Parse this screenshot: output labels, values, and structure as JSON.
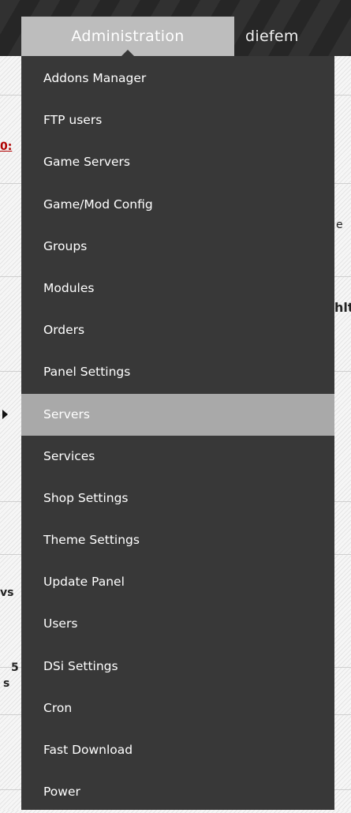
{
  "nav": {
    "tabs": [
      {
        "label": "Administration",
        "active": true
      },
      {
        "label": "diefem",
        "active": false
      }
    ]
  },
  "background_fragments": {
    "link": "0:",
    "e": "e",
    "hlt": "hlt",
    "vs": "vs",
    "five": "5",
    "s": "s"
  },
  "menu": {
    "items": [
      {
        "label": "Addons Manager"
      },
      {
        "label": "FTP users"
      },
      {
        "label": "Game Servers"
      },
      {
        "label": "Game/Mod Config"
      },
      {
        "label": "Groups"
      },
      {
        "label": "Modules"
      },
      {
        "label": "Orders"
      },
      {
        "label": "Panel Settings"
      },
      {
        "label": "Servers",
        "active": true
      },
      {
        "label": "Services"
      },
      {
        "label": "Shop Settings"
      },
      {
        "label": "Theme Settings"
      },
      {
        "label": "Update Panel"
      },
      {
        "label": "Users"
      },
      {
        "label": "DSi Settings"
      },
      {
        "label": "Cron"
      },
      {
        "label": "Fast Download"
      },
      {
        "label": "Power"
      }
    ]
  },
  "colors": {
    "header_bg": "#262626",
    "active_tab_bg": "#bdbdbd",
    "menu_bg": "#383838",
    "active_item_bg": "#a9a9a9",
    "menu_text": "#ffffff"
  }
}
